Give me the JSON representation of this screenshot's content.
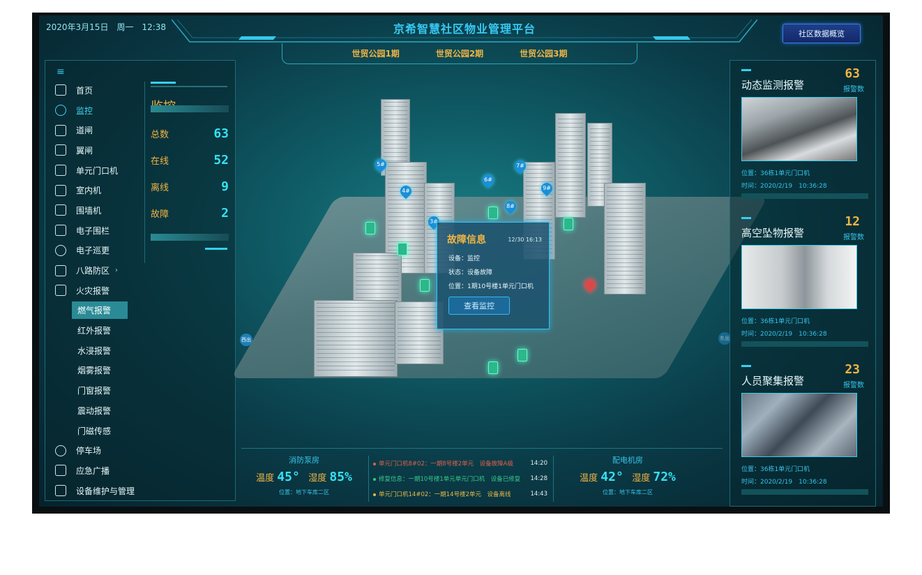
{
  "header": {
    "datetime": "2020年3月15日　周一　12:38",
    "title": "京希智慧社区物业管理平台",
    "phases": [
      "世贸公园1期",
      "世贸公园2期",
      "世贸公园3期"
    ],
    "overview_button": "社区数据概览"
  },
  "sidebar": {
    "menu_icon": "≡",
    "items": [
      {
        "label": "首页",
        "icon": "home-icon"
      },
      {
        "label": "监控",
        "icon": "camera-icon"
      },
      {
        "label": "道闸",
        "icon": "barrier-gate-icon"
      },
      {
        "label": "翼闸",
        "icon": "wing-gate-icon"
      },
      {
        "label": "单元门口机",
        "icon": "door-intercom-icon"
      },
      {
        "label": "室内机",
        "icon": "indoor-unit-icon"
      },
      {
        "label": "围墙机",
        "icon": "wall-unit-icon"
      },
      {
        "label": "电子围栏",
        "icon": "fence-icon"
      },
      {
        "label": "电子巡更",
        "icon": "patrol-pin-icon"
      },
      {
        "label": "八路防区",
        "icon": "alarm-icon"
      },
      {
        "label": "火灾报警",
        "icon": "fire-alarm-icon"
      }
    ],
    "sub_items": [
      "燃气报警",
      "红外报警",
      "水浸报警",
      "烟雾报警",
      "门窗报警",
      "震动报警",
      "门磁传感"
    ],
    "bottom_items": [
      {
        "label": "停车场",
        "icon": "parking-icon"
      },
      {
        "label": "应急广播",
        "icon": "speaker-icon"
      },
      {
        "label": "设备维护与管理",
        "icon": "tools-icon"
      }
    ]
  },
  "monitor": {
    "title": "监控",
    "stats": [
      {
        "label": "总数",
        "value": "63"
      },
      {
        "label": "在线",
        "value": "52"
      },
      {
        "label": "离线",
        "value": "9"
      },
      {
        "label": "故障",
        "value": "2"
      }
    ]
  },
  "map": {
    "pins": [
      "5#",
      "4#",
      "6#",
      "7#",
      "9#",
      "8#",
      "3#"
    ],
    "exit_west": "西出",
    "exit_east": "东出"
  },
  "fault_popup": {
    "title": "故障信息",
    "time": "12/30 16:13",
    "device": "设备：监控",
    "status": "状态：设备故障",
    "location": "位置：1期10号楼1单元门口机",
    "button": "查看监控"
  },
  "bottom": {
    "left_room": {
      "name": "消防泵房",
      "temp_label": "温度",
      "temp": "45°",
      "hum_label": "湿度",
      "hum": "85%",
      "location": "位置：地下车库二区"
    },
    "right_room": {
      "name": "配电机房",
      "temp_label": "温度",
      "temp": "42°",
      "hum_label": "湿度",
      "hum": "72%",
      "location": "位置：地下车库二区"
    },
    "events": [
      {
        "text": "单元门口机8#02：一期8号楼2单元　设备故障A级",
        "time": "14:20",
        "color": "#e0604a"
      },
      {
        "text": "修复信息：一期10号楼1单元单元门口机　设备已修复",
        "time": "14:28",
        "color": "#3ac88a"
      },
      {
        "text": "单元门口机14#02：一期14号楼2单元　设备离线",
        "time": "14:43",
        "color": "#e8b84a"
      }
    ]
  },
  "alerts": [
    {
      "name": "动态监测报警",
      "count": "63",
      "count_label": "报警数",
      "location": "位置：36栋1单元门口机",
      "time": "时间：2020/2/19　10:36:28"
    },
    {
      "name": "高空坠物报警",
      "count": "12",
      "count_label": "报警数",
      "location": "位置：36栋1单元门口机",
      "time": "时间：2020/2/19　10:36:28"
    },
    {
      "name": "人员聚集报警",
      "count": "23",
      "count_label": "报警数",
      "location": "位置：36栋1单元门口机",
      "time": "时间：2020/2/19　10:36:28"
    }
  ]
}
